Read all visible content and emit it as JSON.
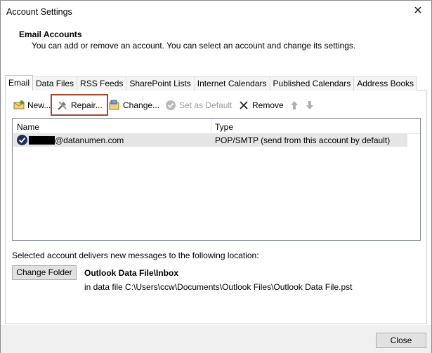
{
  "window": {
    "title": "Account Settings"
  },
  "header": {
    "title": "Email Accounts",
    "description": "You can add or remove an account. You can select an account and change its settings."
  },
  "tabs": [
    {
      "label": "Email",
      "active": true
    },
    {
      "label": "Data Files"
    },
    {
      "label": "RSS Feeds"
    },
    {
      "label": "SharePoint Lists"
    },
    {
      "label": "Internet Calendars"
    },
    {
      "label": "Published Calendars"
    },
    {
      "label": "Address Books"
    }
  ],
  "toolbar": {
    "new_label": "New...",
    "repair_label": "Repair...",
    "change_label": "Change...",
    "set_default_label": "Set as Default",
    "remove_label": "Remove",
    "move_up_icon": "arrow-up-icon",
    "move_down_icon": "arrow-down-icon",
    "highlight_color": "#a34a30"
  },
  "accounts_list": {
    "columns": {
      "name": "Name",
      "type": "Type"
    },
    "rows": [
      {
        "name": "@datanumen.com",
        "type": "POP/SMTP (send from this account by default)",
        "default_icon": "check-circle-icon"
      }
    ]
  },
  "delivery": {
    "label": "Selected account delivers new messages to the following location:",
    "change_folder_label": "Change Folder",
    "folder": "Outlook Data File\\Inbox",
    "path": "in data file C:\\Users\\ccw\\Documents\\Outlook Files\\Outlook Data File.pst"
  },
  "footer": {
    "close_label": "Close"
  }
}
